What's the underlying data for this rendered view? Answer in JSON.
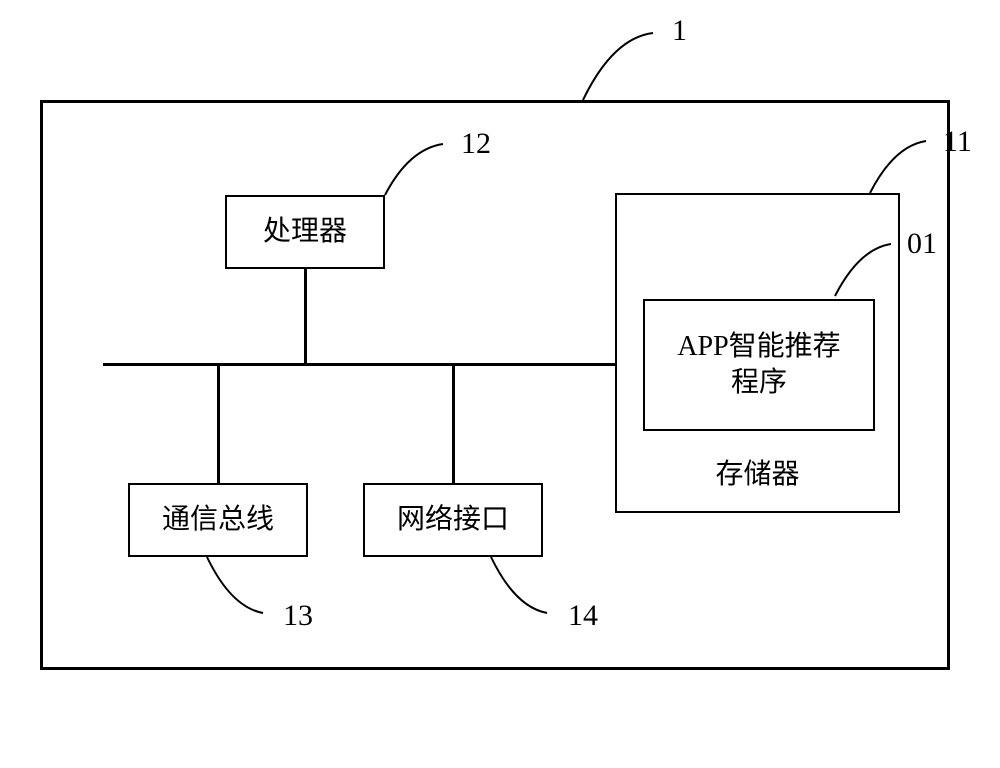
{
  "annotations": {
    "device": "1",
    "memory": "11",
    "program": "01",
    "processor": "12",
    "bus": "13",
    "net": "14"
  },
  "labels": {
    "processor": "处理器",
    "bus": "通信总线",
    "net": "网络接口",
    "program_line1": "APP智能推荐",
    "program_line2": "程序",
    "memory": "存储器"
  }
}
